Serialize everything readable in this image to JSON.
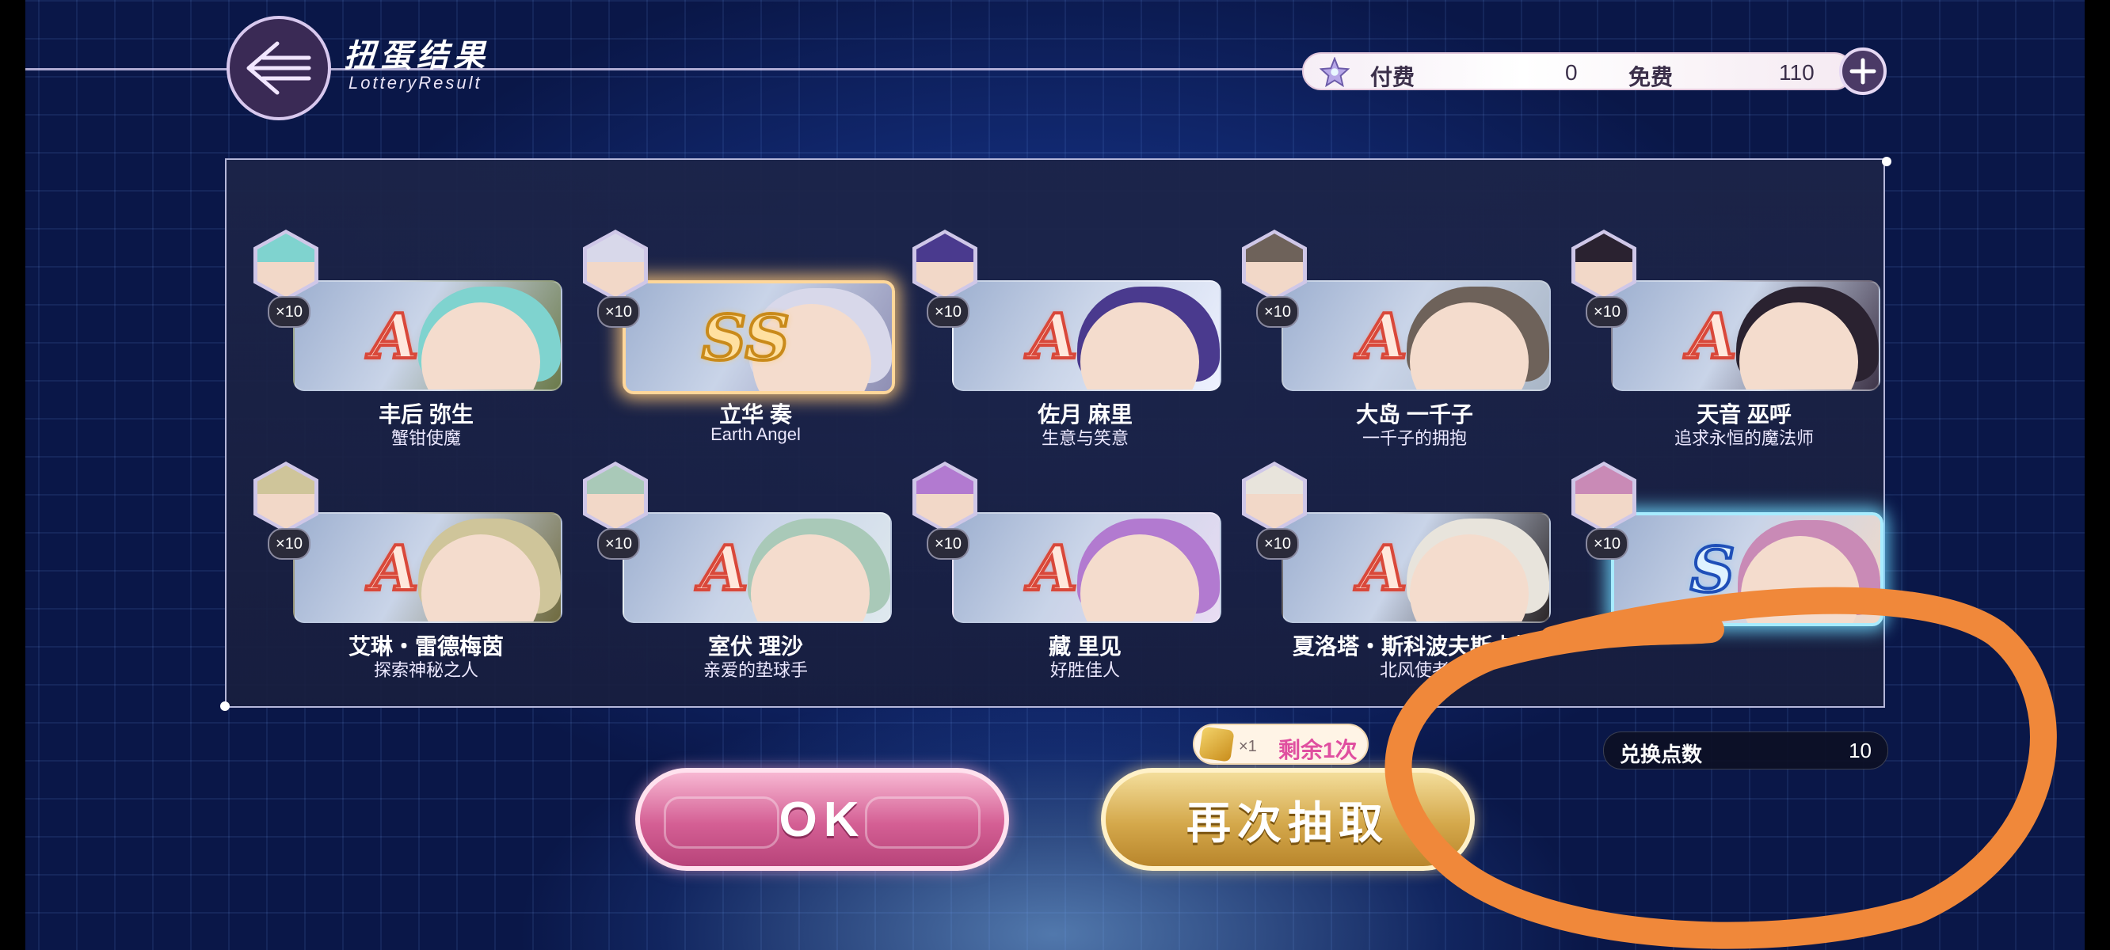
{
  "header": {
    "title": "扭蛋结果",
    "subtitle": "LotteryResult"
  },
  "currency": {
    "paid_label": "付费",
    "paid_value": "0",
    "free_label": "免费",
    "free_value": "110",
    "icon": "star-gem-icon",
    "add_icon": "plus-icon"
  },
  "results": [
    {
      "name": "丰后 弥生",
      "title": "蟹钳使魔",
      "rank": "A",
      "count": "×10",
      "hair": "#7fd3cf",
      "accent": "#6b7a4a"
    },
    {
      "name": "立华 奏",
      "title": "Earth Angel",
      "rank": "SS",
      "count": "×10",
      "hair": "#d8d8ea",
      "accent": "#8f8fb4"
    },
    {
      "name": "佐月 麻里",
      "title": "生意与笑意",
      "rank": "A",
      "count": "×10",
      "hair": "#4a3a8e",
      "accent": "#eef2ff"
    },
    {
      "name": "大岛 一千子",
      "title": "一千子的拥抱",
      "rank": "A",
      "count": "×10",
      "hair": "#6e625a",
      "accent": "#a9b6c6"
    },
    {
      "name": "天音 巫呼",
      "title": "追求永恒的魔法师",
      "rank": "A",
      "count": "×10",
      "hair": "#2a2230",
      "accent": "#3e3448"
    },
    {
      "name": "艾琳・雷德梅茵",
      "title": "探索神秘之人",
      "rank": "A",
      "count": "×10",
      "hair": "#cfc59a",
      "accent": "#6f6a3e"
    },
    {
      "name": "室伏 理沙",
      "title": "亲爱的垫球手",
      "rank": "A",
      "count": "×10",
      "hair": "#a9c9b8",
      "accent": "#dfe9ee"
    },
    {
      "name": "藏 里见",
      "title": "好胜佳人",
      "rank": "A",
      "count": "×10",
      "hair": "#b27ad0",
      "accent": "#e9dcf3"
    },
    {
      "name": "夏洛塔・斯科波夫斯卡娅",
      "title": "北风使者",
      "rank": "A",
      "count": "×10",
      "hair": "#e8e4dc",
      "accent": "#2b2628"
    },
    {
      "name": "",
      "title": "",
      "rank": "S",
      "count": "×10",
      "hair": "#c98ab6",
      "accent": "#f1d9c8"
    }
  ],
  "buttons": {
    "ok": "OK",
    "again": "再次抽取"
  },
  "ticket": {
    "count": "×1",
    "remaining": "剩余1次"
  },
  "exchange": {
    "label": "兑换点数",
    "value": "10"
  },
  "annotation_color": "#f0883a"
}
